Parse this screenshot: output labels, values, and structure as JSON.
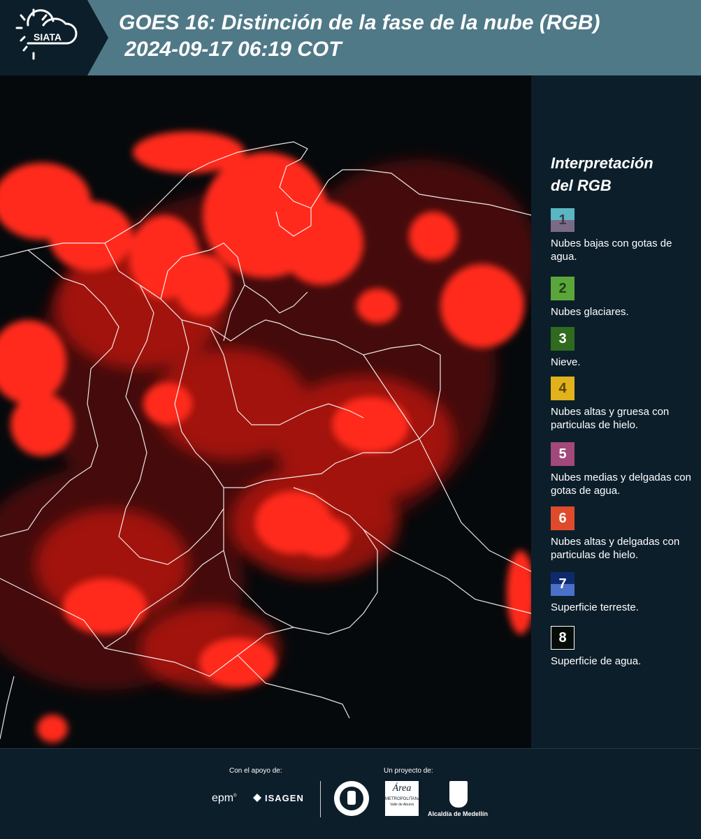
{
  "header": {
    "logo_text": "SIATA",
    "title": "GOES 16: Distinción de la fase de la nube (RGB)\n 2024-09-17 06:19 COT"
  },
  "legend": {
    "title": "Interpretación\ndel RGB",
    "items": [
      {
        "number": "1",
        "label": "Nubes bajas con gotas de agua.",
        "color_top": "#5bb6c3",
        "color_bottom": "#7b6a86"
      },
      {
        "number": "2",
        "label": "Nubes glaciares.",
        "color_top": "#5ba63a",
        "color_bottom": "#5ba63a"
      },
      {
        "number": "3",
        "label": "Nieve.",
        "color_top": "#2f6a1f",
        "color_bottom": "#2f6a1f"
      },
      {
        "number": "4",
        "label": "Nubes altas y gruesa con particulas de hielo.",
        "color_top": "#e2b21c",
        "color_bottom": "#e2b21c"
      },
      {
        "number": "5",
        "label": "Nubes medias y delgadas con gotas de agua.",
        "color_top": "#a2487a",
        "color_bottom": "#a2487a"
      },
      {
        "number": "6",
        "label": "Nubes altas y delgadas con particulas de hielo.",
        "color_top": "#e04a2c",
        "color_bottom": "#e04a2c"
      },
      {
        "number": "7",
        "label": "Superficie terreste.",
        "color_top": "#0f2a6c",
        "color_bottom": "#4a70c8"
      },
      {
        "number": "8",
        "label": "Superficie de agua.",
        "color_top": "#060d08",
        "color_bottom": "#060d08"
      }
    ]
  },
  "footer": {
    "support_label": "Con el apoyo de:",
    "project_label": "Un proyecto de:",
    "epm": "epm",
    "isagen": "ISAGEN",
    "area_metro": "Área",
    "area_metro_sub": "METROPOLITANA",
    "area_metro_sub2": "Valle de Aburrá",
    "alcaldia": "Alcaldía de Medellín"
  },
  "colors": {
    "header_bg": "#507987",
    "panel_bg": "#0c1e2a",
    "cloud_red": "#ff2a1a"
  }
}
